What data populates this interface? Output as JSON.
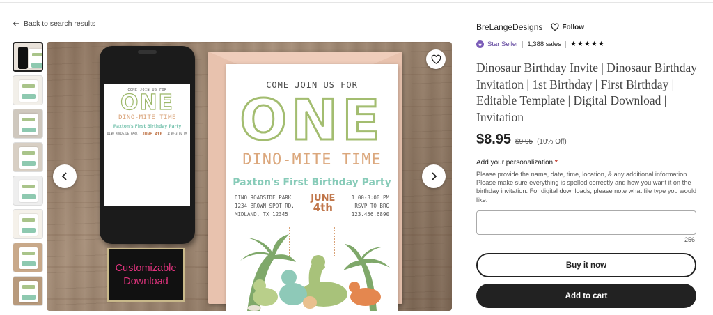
{
  "nav": {
    "back_label": "Back to search results"
  },
  "gallery": {
    "thumbnail_count": 8,
    "active_index": 0,
    "main_image": {
      "phone_screen": {
        "come": "COME JOIN US FOR",
        "one": "ONE",
        "dino": "DINO-MITE TIME",
        "party": "Paxton's First Birthday Party",
        "location": "DINO ROADSIDE PARK",
        "date": "JUNE 4th",
        "time": "1:00-3:00 PM"
      },
      "badge_line1": "Customizable",
      "badge_line2": "Download",
      "card": {
        "come": "COME JOIN US FOR",
        "one": "ONE",
        "dino": "DINO-MITE TIME",
        "party": "Paxton's First Birthday Party",
        "address_1": "DINO ROADSIDE PARK",
        "address_2": "1234 BROWN SPOT RD.",
        "address_3": "MIDLAND, TX 12345",
        "month": "JUNE",
        "day": "4th",
        "time": "1:00-3:00 PM",
        "rsvp": "RSVP TO BRG",
        "phone": "123.456.6890"
      }
    },
    "favorite_icon": "heart-icon",
    "prev_icon": "chevron-left-icon",
    "next_icon": "chevron-right-icon"
  },
  "shop": {
    "name": "BreLangeDesigns",
    "follow_label": "Follow",
    "star_seller_label": "Star Seller",
    "sales": "1,388 sales",
    "stars": "★★★★★"
  },
  "listing": {
    "title": "Dinosaur Birthday Invite | Dinosaur Birthday Invitation | 1st Birthday | First Birthday | Editable Template | Digital Download | Invitation",
    "price": "$8.95",
    "original_price": "$9.95",
    "discount": "(10% Off)"
  },
  "personalization": {
    "label": "Add your personalization",
    "required_mark": "*",
    "help": "Please provide the name, date, time, location, & any additional information. Please make sure everything is spelled correctly and how you want it on the birthday invitation. For digital downloads, please note what file type you would like.",
    "value": "",
    "char_count": "256"
  },
  "actions": {
    "buy_now": "Buy it now",
    "add_to_cart": "Add to cart"
  },
  "colors": {
    "star_seller": "#5b3f9b",
    "required": "#c0392b",
    "primary_button": "#222222",
    "badge_text": "#e0337d"
  }
}
